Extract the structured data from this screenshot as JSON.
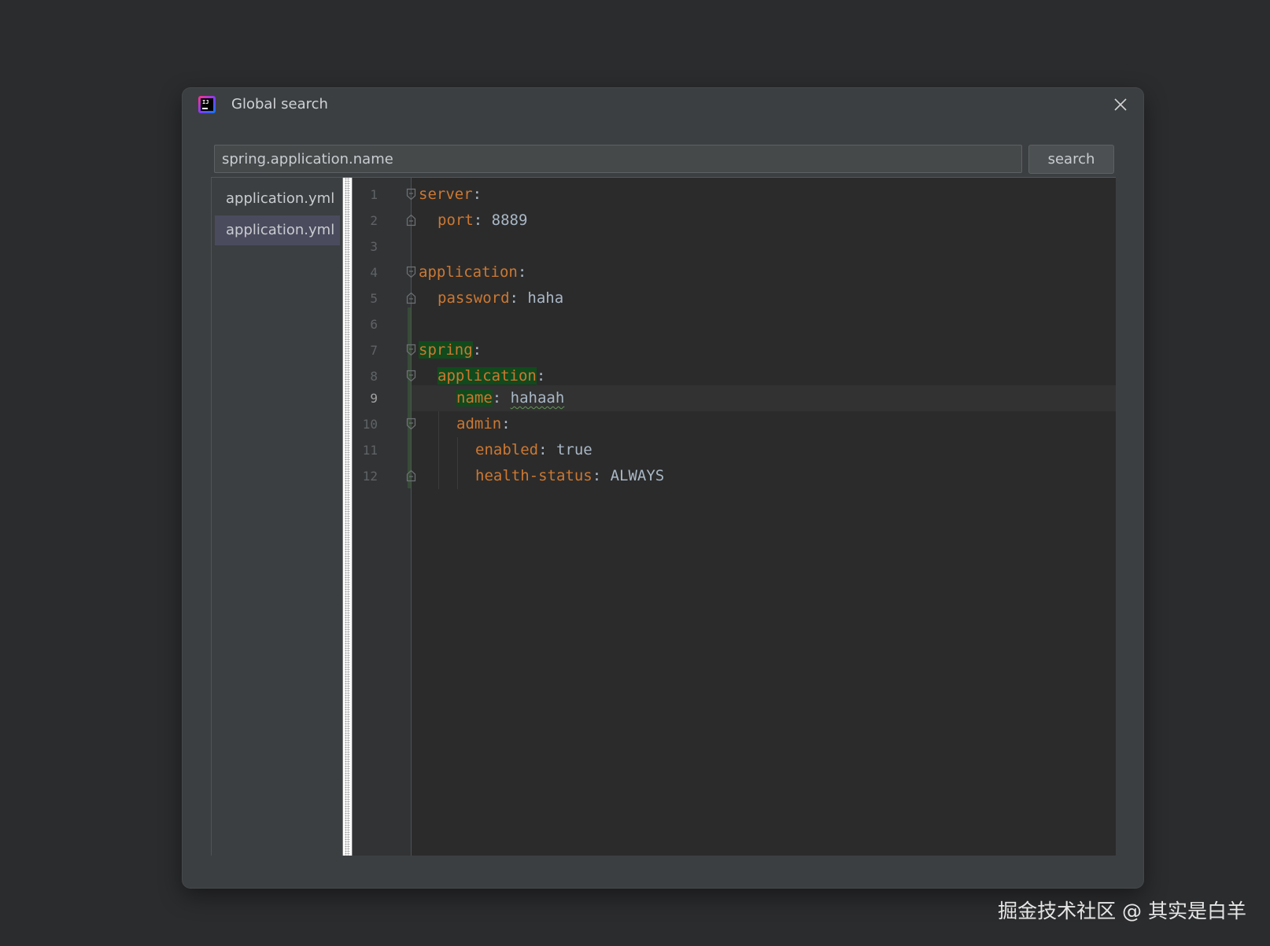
{
  "window": {
    "title": "Global search",
    "close_icon": "close-icon",
    "app_icon": "intellij-idea-icon",
    "app_icon_text": "IJ"
  },
  "search": {
    "value": "spring.application.name",
    "button_label": "search"
  },
  "file_list": {
    "items": [
      {
        "label": "application.yml",
        "selected": false
      },
      {
        "label": "application.yml",
        "selected": true
      }
    ]
  },
  "editor": {
    "current_line": 9,
    "lines": [
      {
        "num": "1",
        "key": "server",
        "sep": ":",
        "value": ""
      },
      {
        "num": "2",
        "key": "port",
        "sep": ": ",
        "value": "8889"
      },
      {
        "num": "3",
        "key": "",
        "sep": "",
        "value": ""
      },
      {
        "num": "4",
        "key": "application",
        "sep": ":",
        "value": ""
      },
      {
        "num": "5",
        "key": "password",
        "sep": ": ",
        "value": "haha"
      },
      {
        "num": "6",
        "key": "",
        "sep": "",
        "value": ""
      },
      {
        "num": "7",
        "key": "spring",
        "sep": ":",
        "value": ""
      },
      {
        "num": "8",
        "key": "application",
        "sep": ":",
        "value": ""
      },
      {
        "num": "9",
        "key": "name",
        "sep": ": ",
        "value": "hahaah"
      },
      {
        "num": "10",
        "key": "admin",
        "sep": ":",
        "value": ""
      },
      {
        "num": "11",
        "key": "enabled",
        "sep": ": ",
        "value": "true"
      },
      {
        "num": "12",
        "key": "health-status",
        "sep": ": ",
        "value": "ALWAYS"
      }
    ]
  },
  "colors": {
    "key": "#cc7832",
    "value": "#a9b7c6",
    "match_highlight": "#114a1c",
    "selected_item": "#4b4b5e"
  },
  "watermark": "掘金技术社区 @ 其实是白羊"
}
